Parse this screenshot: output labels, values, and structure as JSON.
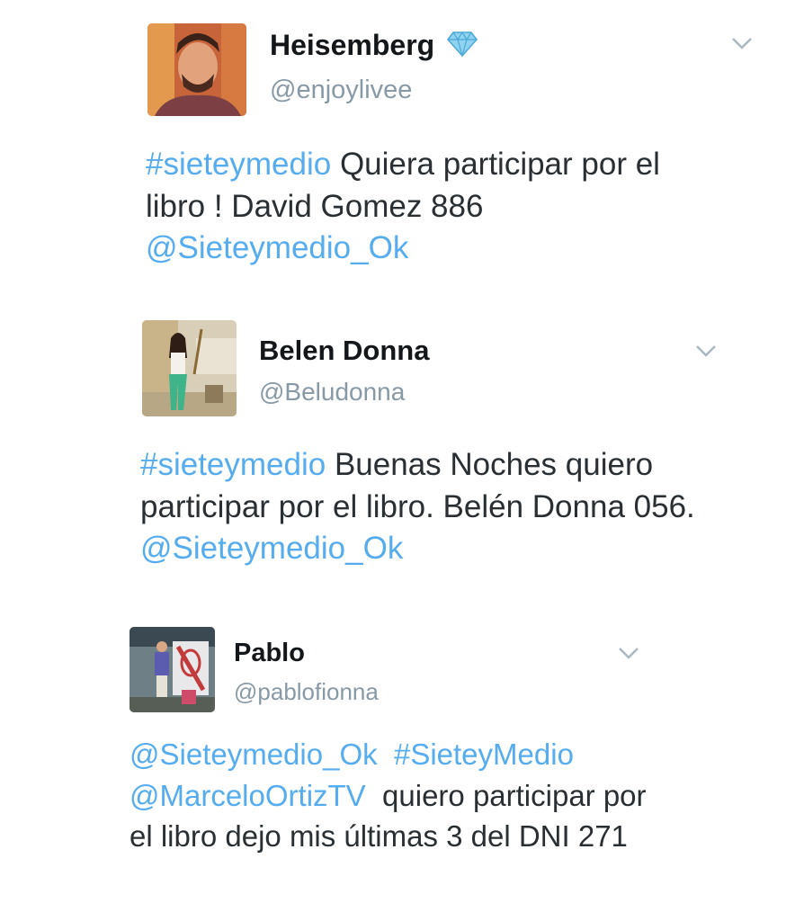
{
  "tweets": [
    {
      "name": "Heisemberg",
      "handle": "@enjoylivee",
      "verified_icon": "diamond-icon",
      "text": [
        {
          "t": "#sieteymedio",
          "link": true
        },
        {
          "t": " Quiera participar por el libro ! David Gomez 886 ",
          "link": false
        },
        {
          "t": "@Sieteymedio_Ok",
          "link": true
        }
      ]
    },
    {
      "name": "Belen Donna",
      "handle": "@Beludonna",
      "text": [
        {
          "t": "#sieteymedio",
          "link": true
        },
        {
          "t": " Buenas Noches quiero participar por el libro. Belén Donna 056. ",
          "link": false
        },
        {
          "t": "@Sieteymedio_Ok",
          "link": true
        }
      ]
    },
    {
      "name": "Pablo",
      "handle": "@pablofionna",
      "text": [
        {
          "t": "@Sieteymedio_Ok",
          "link": true
        },
        {
          "t": "  ",
          "link": false
        },
        {
          "t": "#SieteyMedio",
          "link": true
        },
        {
          "t": " ",
          "link": false
        },
        {
          "t": "@MarceloOrtizTV",
          "link": true
        },
        {
          "t": "  quiero participar por el libro dejo mis últimas 3 del DNI 271",
          "link": false
        }
      ]
    }
  ],
  "colors": {
    "link": "#55acee",
    "text": "#292f33",
    "handle": "#8899a6",
    "name": "#14171a",
    "chevron": "#aab8c2"
  },
  "icons": [
    "chevron-down-icon",
    "diamond-icon"
  ]
}
